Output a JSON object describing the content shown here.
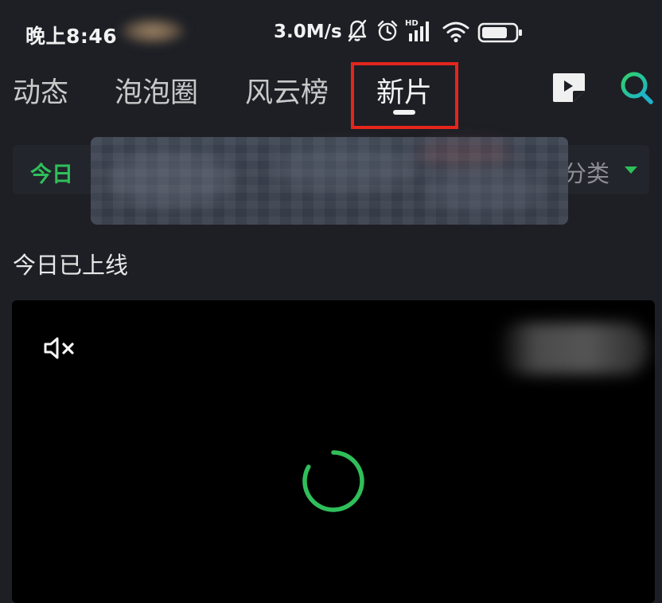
{
  "status_bar": {
    "time": "晚上8:46",
    "network_speed": "3.0M/s",
    "icons": [
      "bell-muted-icon",
      "alarm-icon",
      "hd-signal-icon",
      "wifi-icon",
      "battery-icon"
    ],
    "network_badge": "HD"
  },
  "nav": {
    "tabs": [
      {
        "label": "动态",
        "active": false
      },
      {
        "label": "泡泡圈",
        "active": false
      },
      {
        "label": "风云榜",
        "active": false
      },
      {
        "label": "新片",
        "active": true
      }
    ],
    "icons": [
      "video-collection-icon",
      "search-icon"
    ]
  },
  "filter": {
    "today_label": "今日",
    "category_label": "分类"
  },
  "section": {
    "title": "今日已上线"
  },
  "player": {
    "mute_icon": "volume-muted-icon",
    "loading_icon": "loading-spinner-icon"
  },
  "colors": {
    "background": "#1d1f25",
    "accent_green": "#2fbf5a",
    "highlight_red": "#e5261d",
    "player_bg": "#000000"
  }
}
